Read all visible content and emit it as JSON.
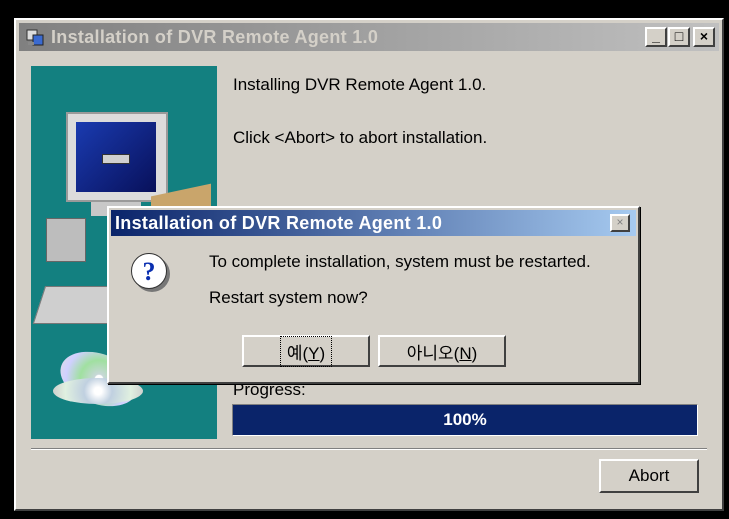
{
  "main_window": {
    "title": "Installation of DVR Remote Agent 1.0",
    "controls": {
      "minimize": "_",
      "maximize": "□",
      "close": "×"
    },
    "message_line1": "Installing DVR Remote Agent 1.0.",
    "message_line2": "Click <Abort> to abort installation.",
    "progress_label": "Progress:",
    "progress_text": "100%",
    "progress_value": 1.0,
    "abort_label": "Abort"
  },
  "message_box": {
    "title": "Installation of DVR Remote Agent 1.0",
    "close": "×",
    "icon": "question-icon",
    "text_line1": "To complete installation, system must be restarted.",
    "text_line2": "Restart system now?",
    "yes_label": "예(",
    "yes_key": "Y",
    "yes_suffix": ")",
    "no_label": "아니오(",
    "no_key": "N",
    "no_suffix": ")"
  },
  "colors": {
    "side_panel": "#138080",
    "progress_fill": "#0a246a",
    "active_title": "#0a246a",
    "inactive_title": "#808080"
  }
}
